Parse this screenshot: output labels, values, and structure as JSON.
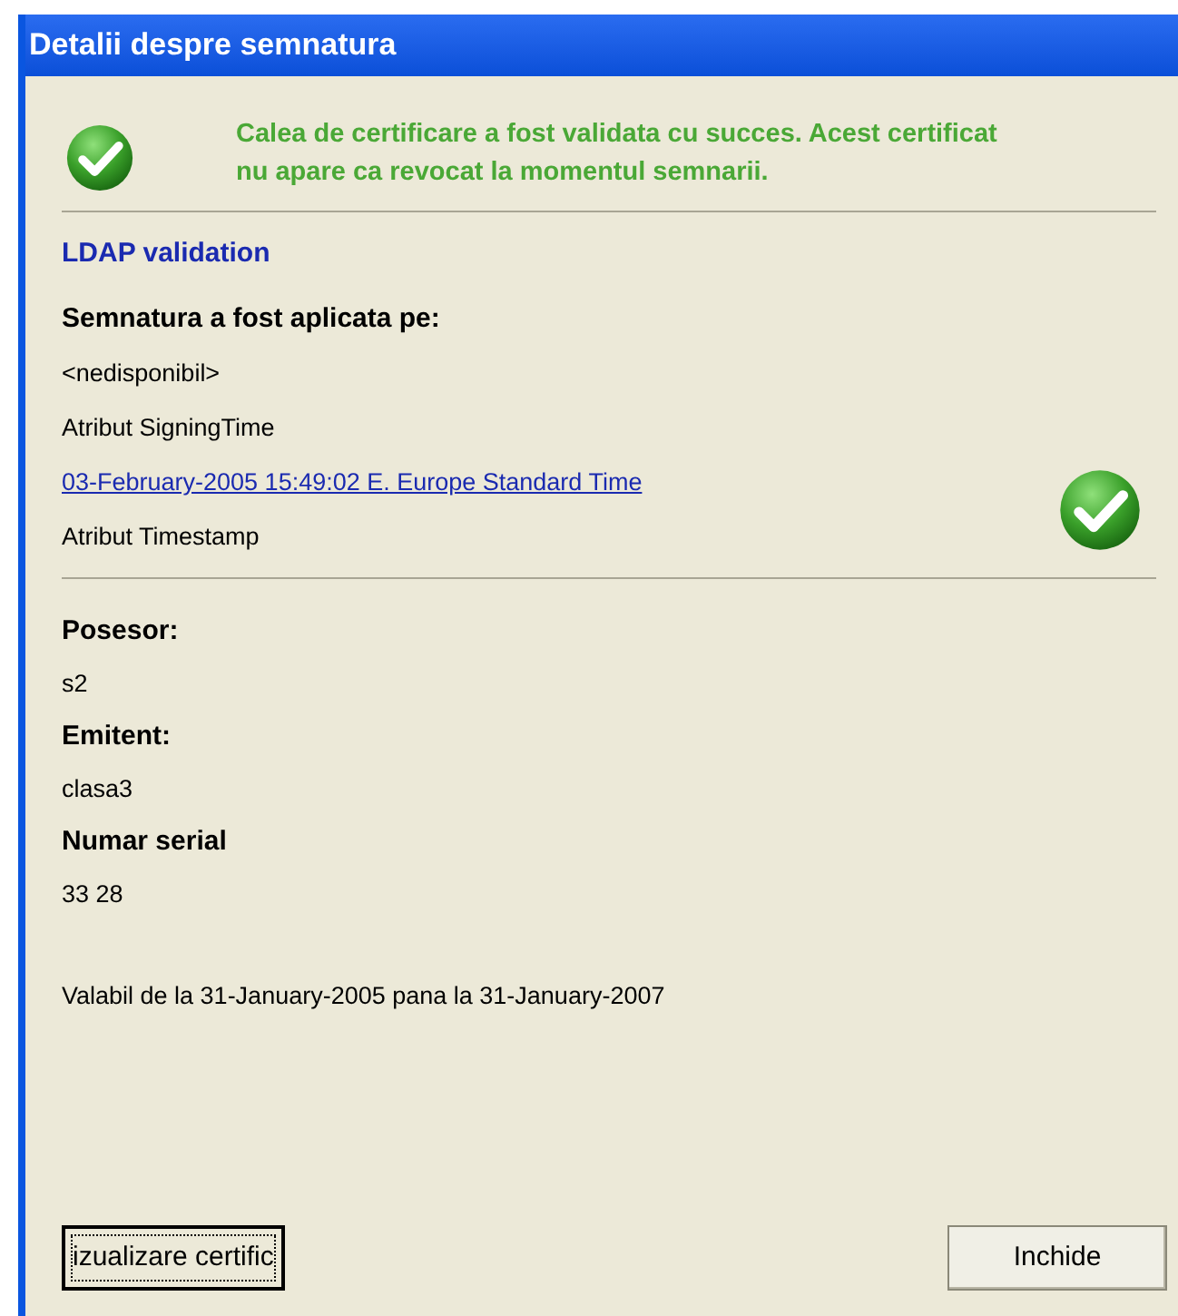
{
  "window": {
    "title": "Detalii despre semnatura"
  },
  "status": {
    "message": "Calea de certificare a fost validata cu succes. Acest certificat nu apare ca revocat la momentul semnarii."
  },
  "validation": {
    "heading": "LDAP validation",
    "signed_on_label": "Semnatura a fost aplicata pe:",
    "signing_time": "<nedisponibil>",
    "signing_time_attribute": "Atribut SigningTime",
    "timestamp_link": "03-February-2005 15:49:02 E. Europe Standard Time",
    "timestamp_attribute": "Atribut Timestamp"
  },
  "certificate": {
    "fields": [
      {
        "label": "Posesor:",
        "value": "s2"
      },
      {
        "label": "Emitent:",
        "value": "clasa3"
      },
      {
        "label": "Numar serial",
        "value": "33 28"
      }
    ],
    "validity": "Valabil de la 31-January-2005 pana la 31-January-2007"
  },
  "buttons": [
    {
      "label": "izualizare certific",
      "focused": true
    },
    {
      "label": "Inchide",
      "focused": false
    }
  ]
}
